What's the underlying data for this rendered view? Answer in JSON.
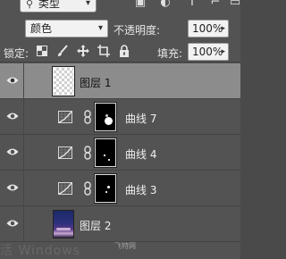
{
  "filter": {
    "kind_label": "类型"
  },
  "blend": {
    "mode": "颜色",
    "opacity_label": "不透明度:",
    "opacity_value": "100%"
  },
  "lock": {
    "label": "锁定:",
    "fill_label": "填充:",
    "fill_value": "100%"
  },
  "layers": [
    {
      "name": "图层 1",
      "type": "pixel",
      "thumb": "transparent",
      "selected": true
    },
    {
      "name": "曲线 7",
      "type": "adjustment",
      "mask": "white-blob-lower-center"
    },
    {
      "name": "曲线 4",
      "type": "adjustment",
      "mask": "small-dots"
    },
    {
      "name": "曲线 3",
      "type": "adjustment",
      "mask": "small-dots-right"
    },
    {
      "name": "图层 2",
      "type": "pixel",
      "thumb": "photo"
    }
  ],
  "watermark": {
    "text": "活 Windows",
    "source": "飞特网"
  },
  "colors": {
    "panel": "#535353",
    "selected_row": "#8c8c8c",
    "field": "#f2f2f2"
  },
  "icons": [
    "eye-icon",
    "curves-adjustment-icon",
    "link-chain-icon",
    "lock-transparent-icon",
    "brush-icon",
    "move-icon",
    "crop-icon",
    "lock-all-icon",
    "text-icon",
    "transform-icon",
    "shape-icon"
  ]
}
